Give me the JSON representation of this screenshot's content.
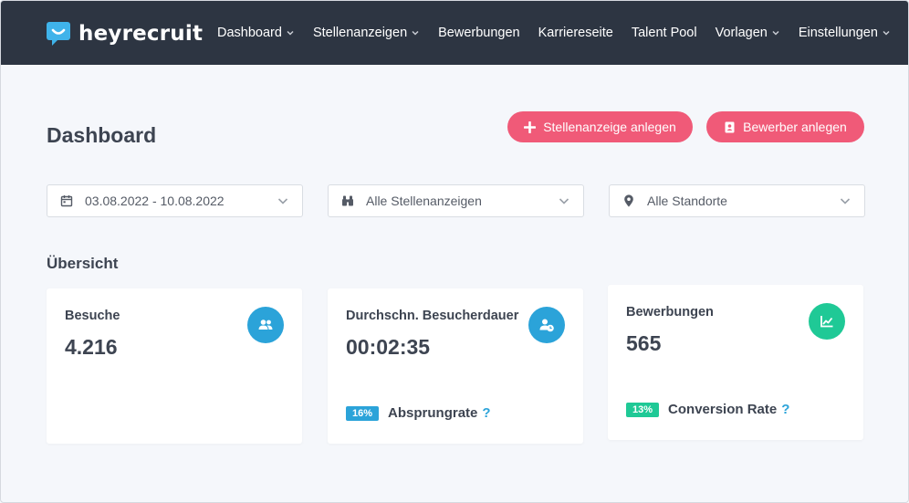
{
  "app": {
    "brand": "heyrecruit"
  },
  "nav": {
    "items": [
      {
        "label": "Dashboard",
        "dropdown": true
      },
      {
        "label": "Stellenanzeigen",
        "dropdown": true
      },
      {
        "label": "Bewerbungen",
        "dropdown": false
      },
      {
        "label": "Karriereseite",
        "dropdown": false
      },
      {
        "label": "Talent Pool",
        "dropdown": false
      },
      {
        "label": "Vorlagen",
        "dropdown": true
      },
      {
        "label": "Einstellungen",
        "dropdown": true
      }
    ]
  },
  "header": {
    "title": "Dashboard",
    "create_job_label": "Stellenanzeige anlegen",
    "create_applicant_label": "Bewerber anlegen"
  },
  "filters": {
    "date_range": "03.08.2022 - 10.08.2022",
    "jobs": "Alle Stellenanzeigen",
    "locations": "Alle Standorte"
  },
  "overview": {
    "title": "Übersicht",
    "visits": {
      "label": "Besuche",
      "value": "4.216"
    },
    "duration": {
      "label": "Durchschn. Besucherdauer",
      "value": "00:02:35",
      "badge": "16%",
      "foot_label": "Absprungrate",
      "help": "?"
    },
    "applications": {
      "label": "Bewerbungen",
      "value": "565",
      "badge": "13%",
      "foot_label": "Conversion Rate",
      "help": "?"
    }
  },
  "colors": {
    "topbar": "#2d3542",
    "accent_pink": "#f05a78",
    "accent_blue": "#2ba3d9",
    "accent_green": "#1fc996",
    "background": "#f5f7fb"
  },
  "icons": {
    "logo": "chat-smile-icon",
    "nav_dropdown": "chevron-down-icon",
    "create_job": "plus-icon",
    "create_applicant": "contact-book-icon",
    "date": "calendar-icon",
    "jobs": "binoculars-icon",
    "locations": "map-pin-icon",
    "visits": "users-icon",
    "duration": "user-clock-icon",
    "applications": "chart-line-icon"
  }
}
